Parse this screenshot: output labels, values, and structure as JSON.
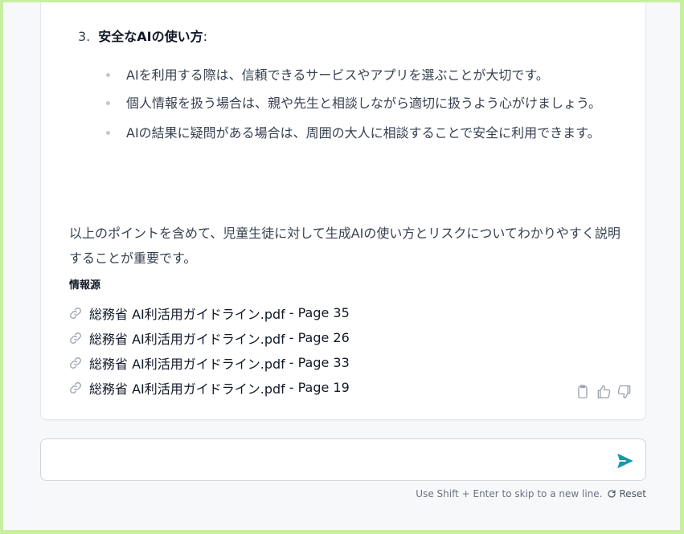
{
  "answer": {
    "numbered_item": {
      "number": "3.",
      "title": "安全なAIの使い方",
      "suffix": ":"
    },
    "bullets": [
      "AIを利用する際は、信頼できるサービスやアプリを選ぶことが大切です。",
      "個人情報を扱う場合は、親や先生と相談しながら適切に扱うよう心がけましょう。",
      "AIの結果に疑問がある場合は、周囲の大人に相談することで安全に利用できます。"
    ],
    "summary": "以上のポイントを含めて、児童生徒に対して生成AIの使い方とリスクについてわかりやすく説明することが重要です。"
  },
  "sources": {
    "title": "情報源",
    "items": [
      {
        "name": "総務省 AI利活用ガイドライン.pdf",
        "sep": "-",
        "page": "Page 35"
      },
      {
        "name": "総務省 AI利活用ガイドライン.pdf",
        "sep": "-",
        "page": "Page 26"
      },
      {
        "name": "総務省 AI利活用ガイドライン.pdf",
        "sep": "-",
        "page": "Page 33"
      },
      {
        "name": "総務省 AI利活用ガイドライン.pdf",
        "sep": "-",
        "page": "Page 19"
      }
    ]
  },
  "actions": {
    "icons": [
      "clipboard-icon",
      "thumbs-up-icon",
      "thumbs-down-icon"
    ]
  },
  "composer": {
    "value": "",
    "placeholder": "",
    "send_icon": "send-icon"
  },
  "footer": {
    "hint": "Use Shift + Enter to skip to a new line.",
    "reset_label": "Reset",
    "reset_icon": "refresh-icon"
  },
  "colors": {
    "outer_border": "#c8eea0",
    "send_accent": "#1a97a6",
    "text": "#374151",
    "heading": "#111827"
  }
}
